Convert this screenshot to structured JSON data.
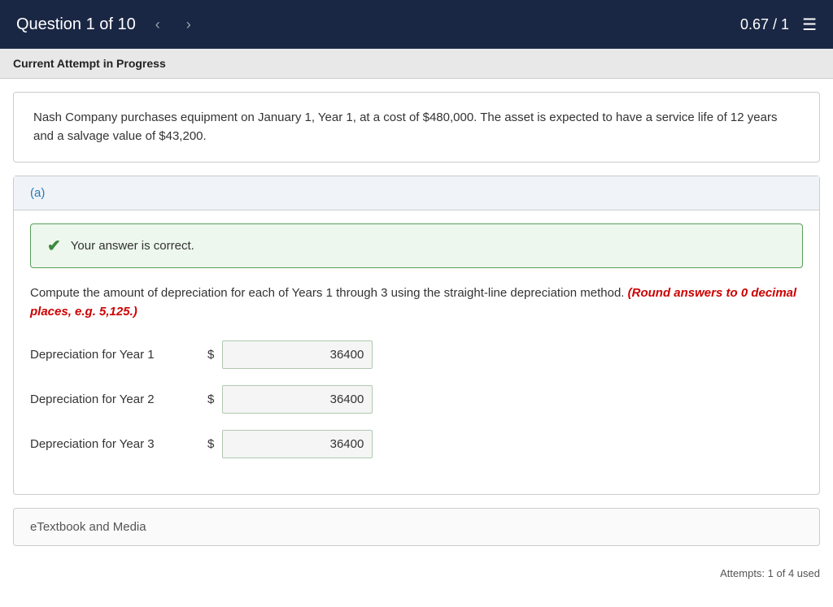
{
  "topBar": {
    "questionLabel": "Question 1 of 10",
    "prevArrow": "‹",
    "nextArrow": "›",
    "score": "0.67 / 1",
    "menuIcon": "☰"
  },
  "currentAttempt": {
    "label": "Current Attempt in Progress"
  },
  "questionText": "Nash Company purchases equipment on January 1, Year 1, at a cost of $480,000. The asset is expected to have a service life of 12 years and a salvage value of $43,200.",
  "partA": {
    "label": "(a)",
    "correctMessage": "Your answer is correct.",
    "instruction": "Compute the amount of depreciation for each of Years 1 through 3 using the straight-line depreciation method.",
    "roundNote": "(Round answers to 0 decimal places, e.g. 5,125.)",
    "rows": [
      {
        "label": "Depreciation for Year 1",
        "dollar": "$",
        "value": "36400"
      },
      {
        "label": "Depreciation for Year 2",
        "dollar": "$",
        "value": "36400"
      },
      {
        "label": "Depreciation for Year 3",
        "dollar": "$",
        "value": "36400"
      }
    ]
  },
  "etextbook": {
    "label": "eTextbook and Media"
  },
  "attempts": {
    "label": "Attempts: 1 of 4 used"
  }
}
